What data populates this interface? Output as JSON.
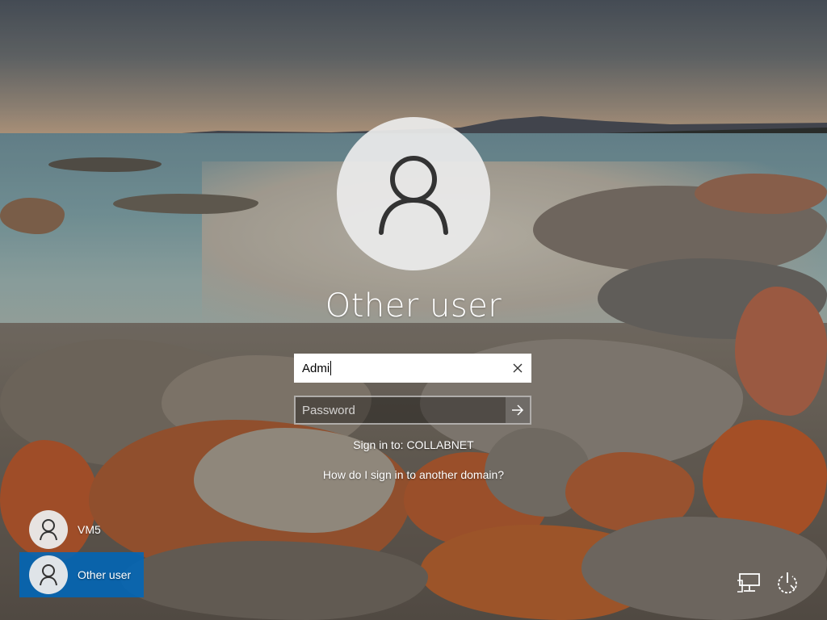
{
  "login": {
    "user_display_name": "Other user",
    "username_value": "Admi",
    "password_placeholder": "Password",
    "sign_in_to": "Sign in to: COLLABNET",
    "domain_help_link": "How do I sign in to another domain?"
  },
  "user_switcher": {
    "items": [
      {
        "label": "VM5",
        "selected": false
      },
      {
        "label": "Other user",
        "selected": true
      }
    ]
  },
  "icons": {
    "avatar": "person-icon",
    "clear": "close-icon",
    "submit": "arrow-right-icon",
    "network": "network-icon",
    "power": "power-icon"
  },
  "colors": {
    "selected_tile": "#0067b8",
    "text": "#ffffff"
  }
}
